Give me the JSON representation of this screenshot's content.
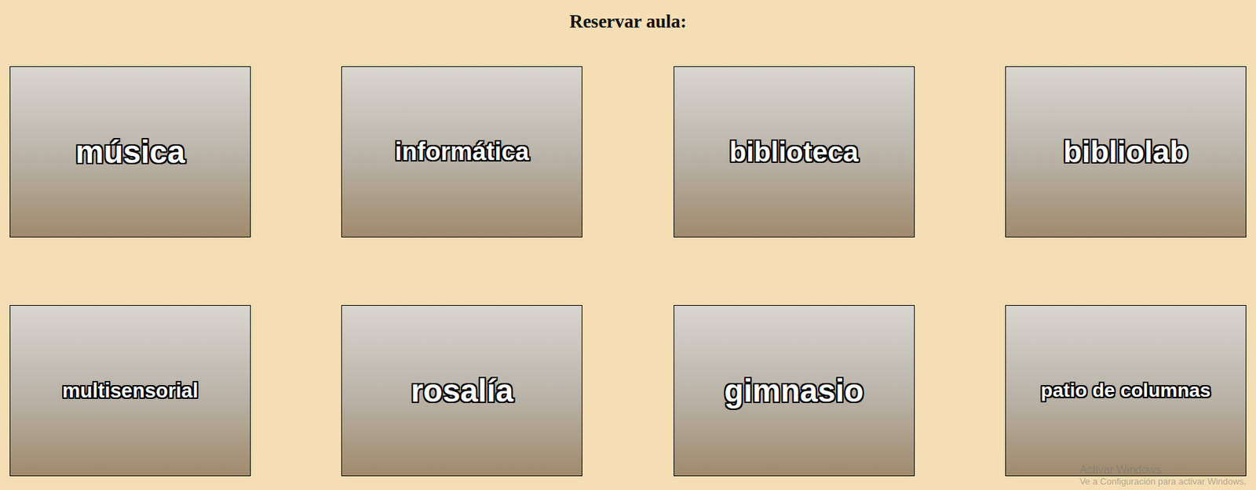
{
  "page": {
    "title": "Reservar aula:"
  },
  "rooms": [
    {
      "label": "música"
    },
    {
      "label": "informática"
    },
    {
      "label": "biblioteca"
    },
    {
      "label": "bibliolab"
    },
    {
      "label": "multisensorial"
    },
    {
      "label": "rosalía"
    },
    {
      "label": "gimnasio"
    },
    {
      "label": "patio de columnas"
    }
  ],
  "watermark": {
    "title": "Activar Windows",
    "subtitle": "Ve a Configuración para activar Windows."
  }
}
